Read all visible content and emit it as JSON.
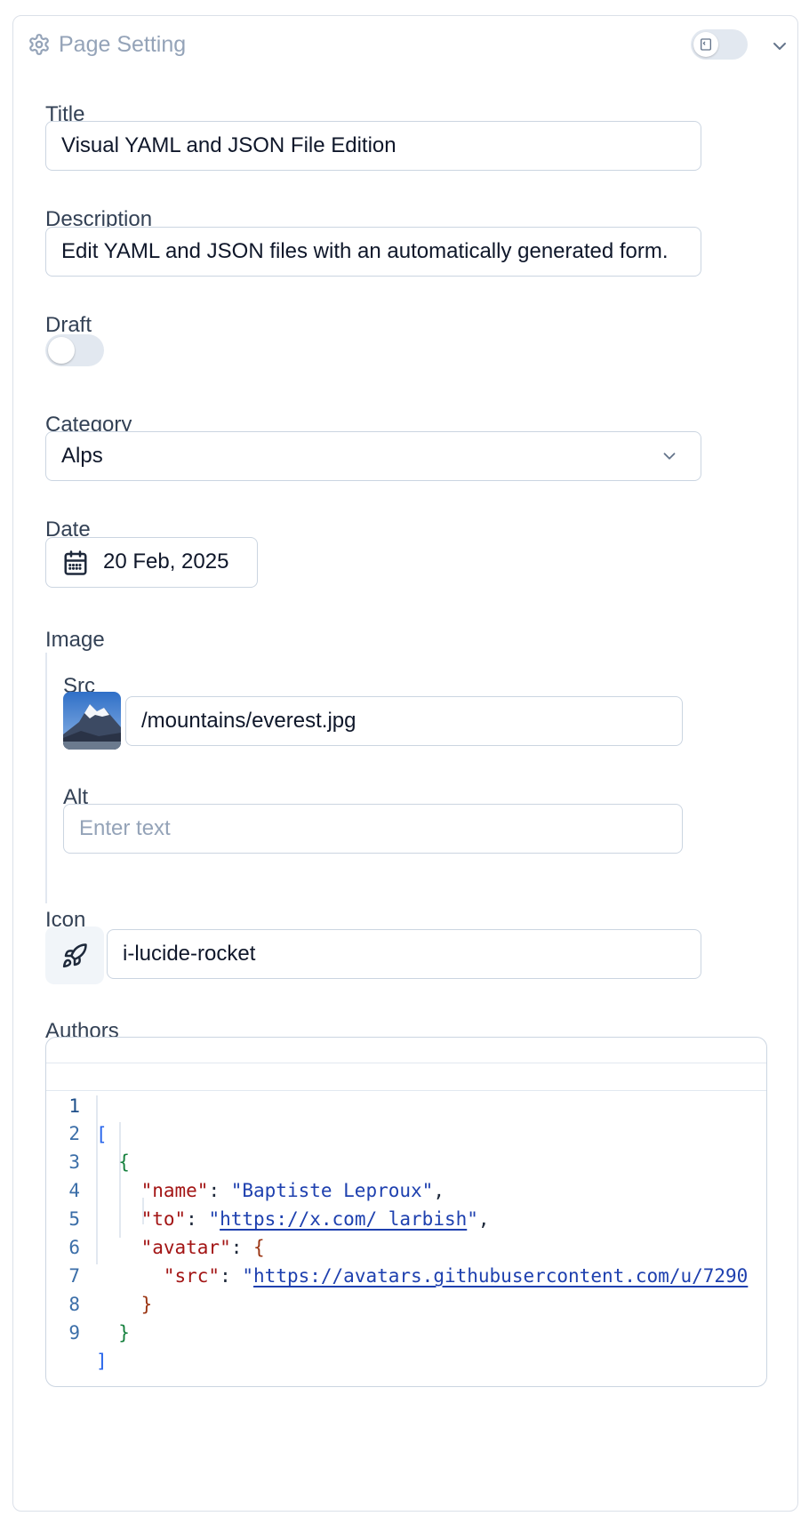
{
  "panel": {
    "title": "Page Setting",
    "header_toggle_on": false,
    "header_icon": "gear-icon",
    "collapse_icon": "chevron-down-icon"
  },
  "fields": {
    "title": {
      "label": "Title",
      "value": "Visual YAML and JSON File Edition"
    },
    "description": {
      "label": "Description",
      "value": "Edit YAML and JSON files with an automatically generated form."
    },
    "draft": {
      "label": "Draft",
      "value": false
    },
    "category": {
      "label": "Category",
      "value": "Alps"
    },
    "date": {
      "label": "Date",
      "value": "20 Feb, 2025"
    },
    "image": {
      "label": "Image",
      "src": {
        "label": "Src",
        "value": "/mountains/everest.jpg"
      },
      "alt": {
        "label": "Alt",
        "placeholder": "Enter text"
      }
    },
    "icon": {
      "label": "Icon",
      "value": "i-lucide-rocket",
      "preview_icon": "rocket-icon"
    },
    "authors": {
      "label": "Authors",
      "line_numbers": [
        "1",
        "2",
        "3",
        "4",
        "5",
        "6",
        "7",
        "8",
        "9"
      ],
      "tokens": {
        "open_bracket": "[",
        "open_brace": "{",
        "name_key": "\"name\"",
        "name_value": "\"Baptiste Leproux\"",
        "to_key": "\"to\"",
        "to_value": "https://x.com/_larbish",
        "avatar_key": "\"avatar\"",
        "avatar_open": "{",
        "src_key": "\"src\"",
        "src_value": "https://avatars.githubusercontent.com/u/7290",
        "avatar_close": "}",
        "close_brace": "}",
        "close_bracket": "]",
        "colon": ": ",
        "comma": ",",
        "quote": "\""
      }
    }
  },
  "colors": {
    "border": "#cbd5e1",
    "muted_text": "#94a3b8",
    "json_key": "#a31515",
    "json_string": "#1e40af",
    "json_bracket": "#2563eb",
    "json_brace": "#15803d"
  }
}
